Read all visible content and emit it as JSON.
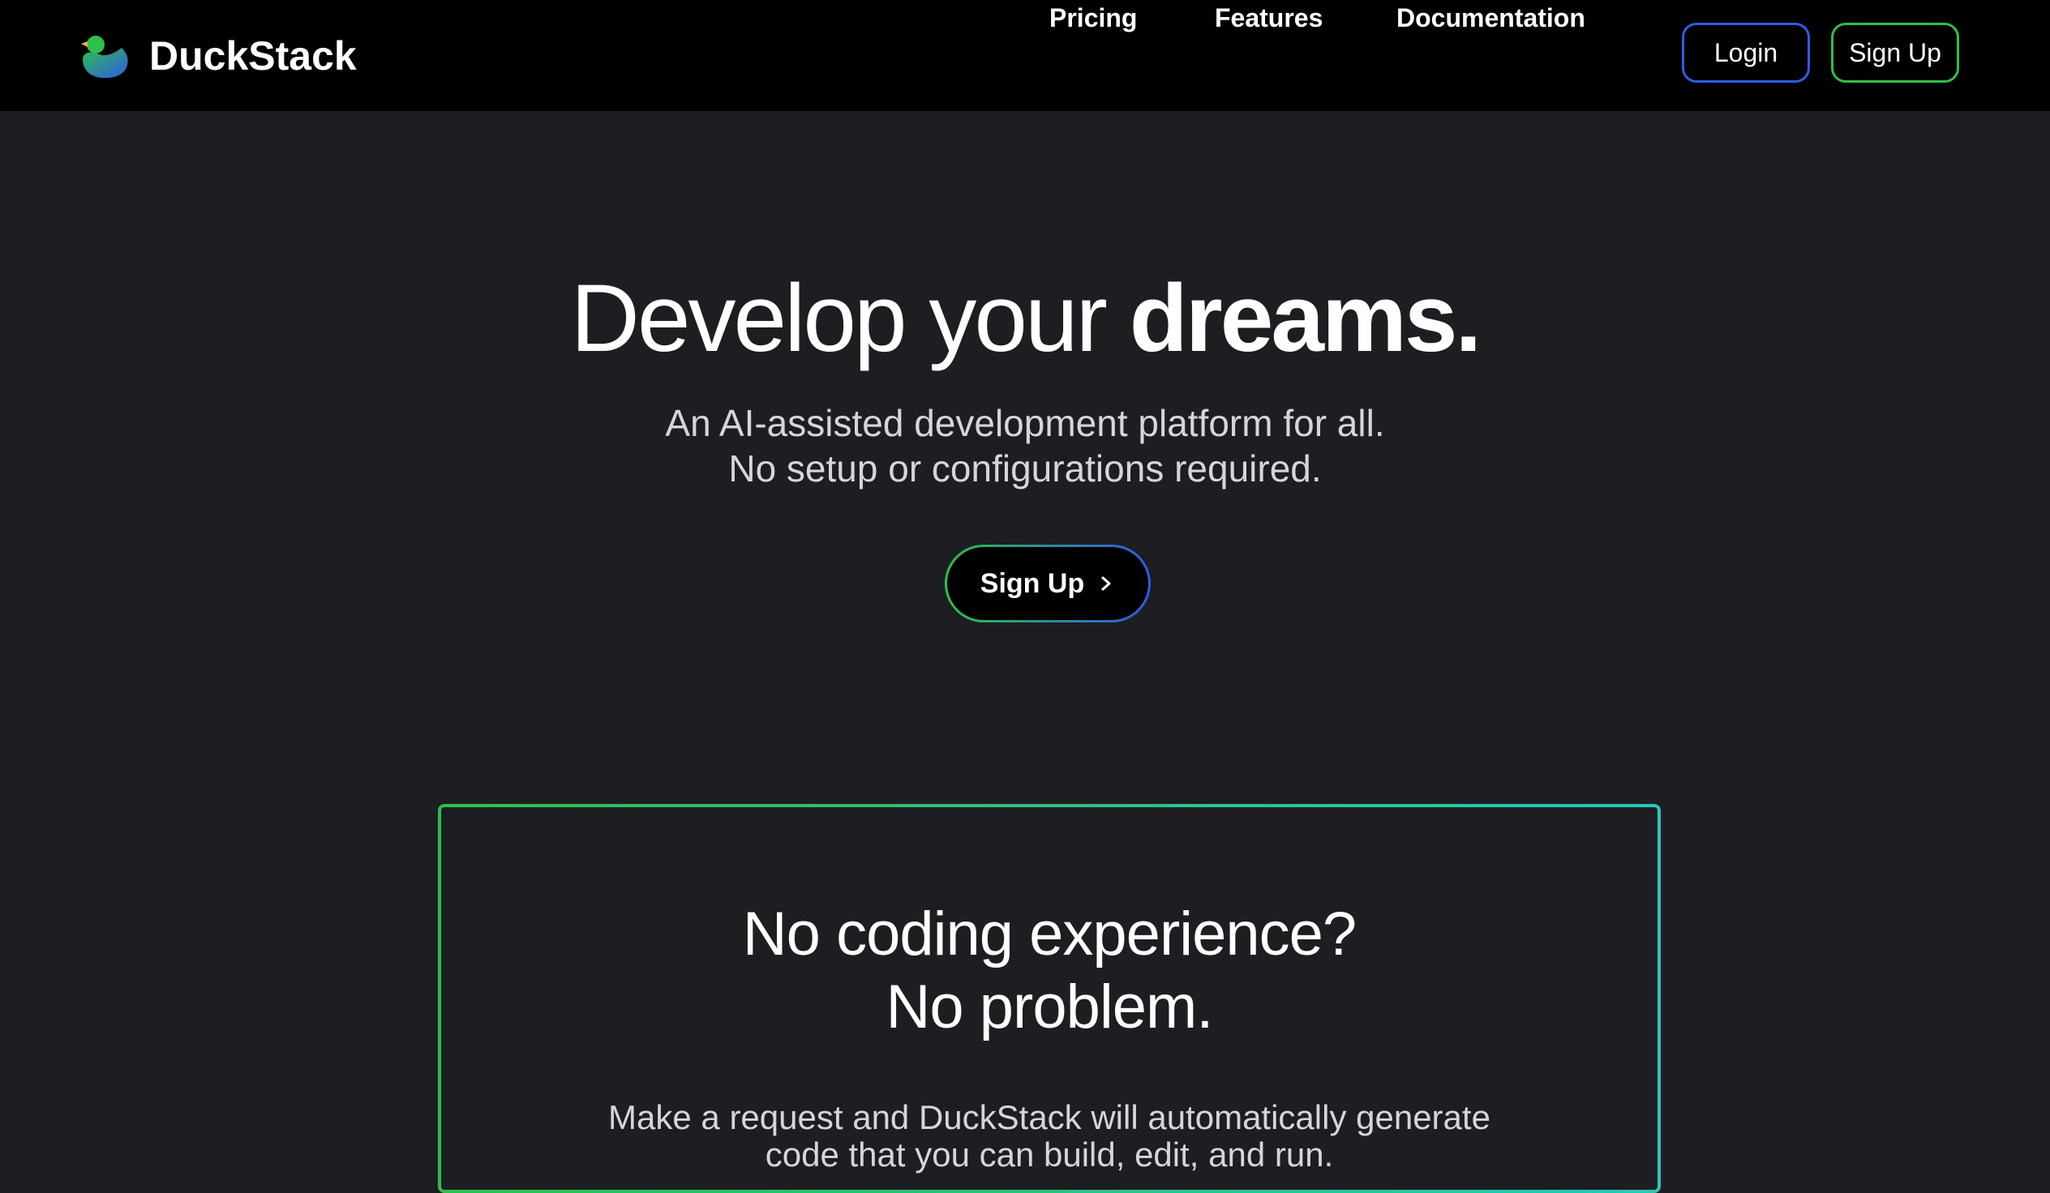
{
  "nav": {
    "brand": "DuckStack",
    "links": [
      "Pricing",
      "Features",
      "Documentation"
    ],
    "login_label": "Login",
    "signup_label": "Sign Up"
  },
  "hero": {
    "title_light": "Develop your",
    "title_bold": "dreams.",
    "subtitle_line1": "An AI-assisted development platform for all.",
    "subtitle_line2": "No setup or configurations required.",
    "cta_label": "Sign Up"
  },
  "feature": {
    "title_line1": "No coding experience?",
    "title_line2": "No problem.",
    "body_line1": "Make a request and DuckStack will automatically generate",
    "body_line2": "code that you can build, edit, and run."
  },
  "colors": {
    "page_bg": "#1d1e22",
    "nav_bg": "#000000",
    "accent_blue": "#2f5be8",
    "accent_green": "#2fbf4a",
    "accent_teal": "#29c7b8"
  },
  "icons": {
    "brand": "duck-logo-icon",
    "cta": "chevron-right-icon"
  }
}
